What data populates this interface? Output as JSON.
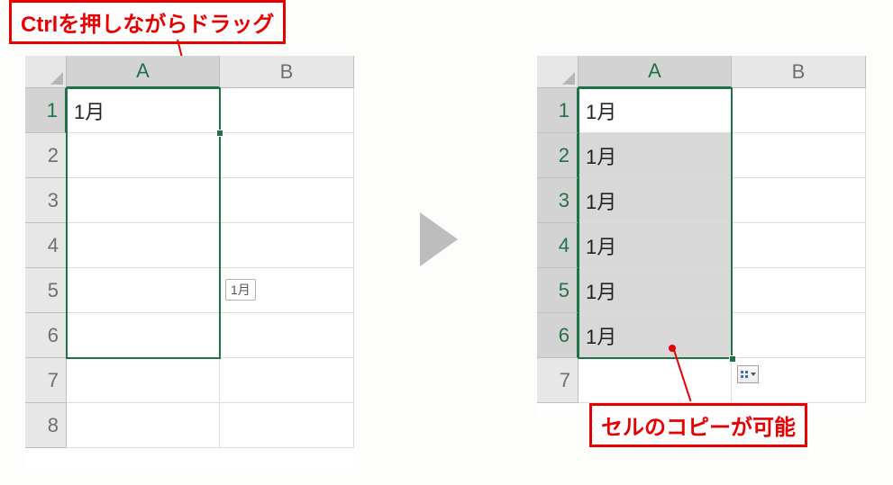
{
  "callouts": {
    "left": "Ctrlを押しながらドラッグ",
    "right": "セルのコピーが可能"
  },
  "columns": [
    "A",
    "B"
  ],
  "left_sheet": {
    "rows": [
      "1",
      "2",
      "3",
      "4",
      "5",
      "6",
      "7",
      "8"
    ],
    "cells": {
      "A1": "1月"
    },
    "fill_tooltip": "1月"
  },
  "right_sheet": {
    "rows": [
      "1",
      "2",
      "3",
      "4",
      "5",
      "6",
      "7"
    ],
    "cells": {
      "A1": "1月",
      "A2": "1月",
      "A3": "1月",
      "A4": "1月",
      "A5": "1月",
      "A6": "1月"
    }
  }
}
